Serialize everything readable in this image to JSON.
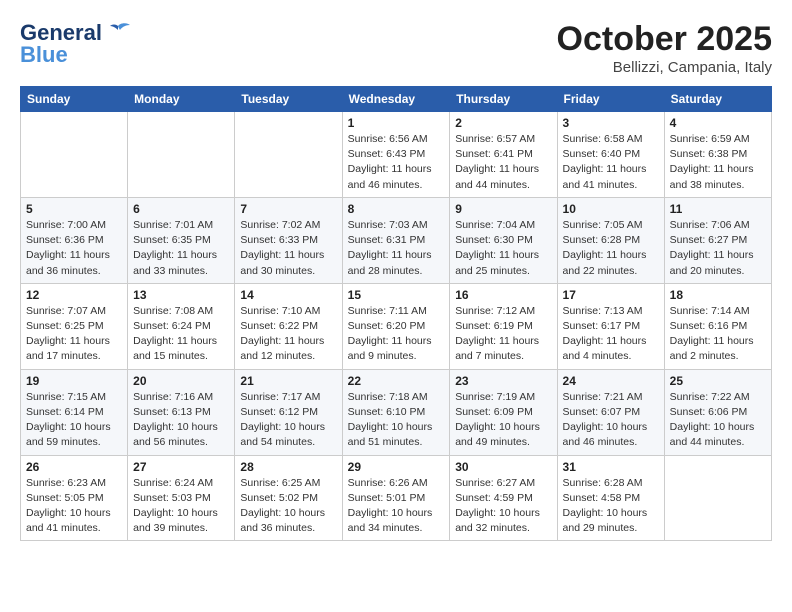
{
  "header": {
    "logo_line1": "General",
    "logo_line2": "Blue",
    "month": "October 2025",
    "location": "Bellizzi, Campania, Italy"
  },
  "days_of_week": [
    "Sunday",
    "Monday",
    "Tuesday",
    "Wednesday",
    "Thursday",
    "Friday",
    "Saturday"
  ],
  "weeks": [
    [
      {
        "day": "",
        "info": ""
      },
      {
        "day": "",
        "info": ""
      },
      {
        "day": "",
        "info": ""
      },
      {
        "day": "1",
        "info": "Sunrise: 6:56 AM\nSunset: 6:43 PM\nDaylight: 11 hours\nand 46 minutes."
      },
      {
        "day": "2",
        "info": "Sunrise: 6:57 AM\nSunset: 6:41 PM\nDaylight: 11 hours\nand 44 minutes."
      },
      {
        "day": "3",
        "info": "Sunrise: 6:58 AM\nSunset: 6:40 PM\nDaylight: 11 hours\nand 41 minutes."
      },
      {
        "day": "4",
        "info": "Sunrise: 6:59 AM\nSunset: 6:38 PM\nDaylight: 11 hours\nand 38 minutes."
      }
    ],
    [
      {
        "day": "5",
        "info": "Sunrise: 7:00 AM\nSunset: 6:36 PM\nDaylight: 11 hours\nand 36 minutes."
      },
      {
        "day": "6",
        "info": "Sunrise: 7:01 AM\nSunset: 6:35 PM\nDaylight: 11 hours\nand 33 minutes."
      },
      {
        "day": "7",
        "info": "Sunrise: 7:02 AM\nSunset: 6:33 PM\nDaylight: 11 hours\nand 30 minutes."
      },
      {
        "day": "8",
        "info": "Sunrise: 7:03 AM\nSunset: 6:31 PM\nDaylight: 11 hours\nand 28 minutes."
      },
      {
        "day": "9",
        "info": "Sunrise: 7:04 AM\nSunset: 6:30 PM\nDaylight: 11 hours\nand 25 minutes."
      },
      {
        "day": "10",
        "info": "Sunrise: 7:05 AM\nSunset: 6:28 PM\nDaylight: 11 hours\nand 22 minutes."
      },
      {
        "day": "11",
        "info": "Sunrise: 7:06 AM\nSunset: 6:27 PM\nDaylight: 11 hours\nand 20 minutes."
      }
    ],
    [
      {
        "day": "12",
        "info": "Sunrise: 7:07 AM\nSunset: 6:25 PM\nDaylight: 11 hours\nand 17 minutes."
      },
      {
        "day": "13",
        "info": "Sunrise: 7:08 AM\nSunset: 6:24 PM\nDaylight: 11 hours\nand 15 minutes."
      },
      {
        "day": "14",
        "info": "Sunrise: 7:10 AM\nSunset: 6:22 PM\nDaylight: 11 hours\nand 12 minutes."
      },
      {
        "day": "15",
        "info": "Sunrise: 7:11 AM\nSunset: 6:20 PM\nDaylight: 11 hours\nand 9 minutes."
      },
      {
        "day": "16",
        "info": "Sunrise: 7:12 AM\nSunset: 6:19 PM\nDaylight: 11 hours\nand 7 minutes."
      },
      {
        "day": "17",
        "info": "Sunrise: 7:13 AM\nSunset: 6:17 PM\nDaylight: 11 hours\nand 4 minutes."
      },
      {
        "day": "18",
        "info": "Sunrise: 7:14 AM\nSunset: 6:16 PM\nDaylight: 11 hours\nand 2 minutes."
      }
    ],
    [
      {
        "day": "19",
        "info": "Sunrise: 7:15 AM\nSunset: 6:14 PM\nDaylight: 10 hours\nand 59 minutes."
      },
      {
        "day": "20",
        "info": "Sunrise: 7:16 AM\nSunset: 6:13 PM\nDaylight: 10 hours\nand 56 minutes."
      },
      {
        "day": "21",
        "info": "Sunrise: 7:17 AM\nSunset: 6:12 PM\nDaylight: 10 hours\nand 54 minutes."
      },
      {
        "day": "22",
        "info": "Sunrise: 7:18 AM\nSunset: 6:10 PM\nDaylight: 10 hours\nand 51 minutes."
      },
      {
        "day": "23",
        "info": "Sunrise: 7:19 AM\nSunset: 6:09 PM\nDaylight: 10 hours\nand 49 minutes."
      },
      {
        "day": "24",
        "info": "Sunrise: 7:21 AM\nSunset: 6:07 PM\nDaylight: 10 hours\nand 46 minutes."
      },
      {
        "day": "25",
        "info": "Sunrise: 7:22 AM\nSunset: 6:06 PM\nDaylight: 10 hours\nand 44 minutes."
      }
    ],
    [
      {
        "day": "26",
        "info": "Sunrise: 6:23 AM\nSunset: 5:05 PM\nDaylight: 10 hours\nand 41 minutes."
      },
      {
        "day": "27",
        "info": "Sunrise: 6:24 AM\nSunset: 5:03 PM\nDaylight: 10 hours\nand 39 minutes."
      },
      {
        "day": "28",
        "info": "Sunrise: 6:25 AM\nSunset: 5:02 PM\nDaylight: 10 hours\nand 36 minutes."
      },
      {
        "day": "29",
        "info": "Sunrise: 6:26 AM\nSunset: 5:01 PM\nDaylight: 10 hours\nand 34 minutes."
      },
      {
        "day": "30",
        "info": "Sunrise: 6:27 AM\nSunset: 4:59 PM\nDaylight: 10 hours\nand 32 minutes."
      },
      {
        "day": "31",
        "info": "Sunrise: 6:28 AM\nSunset: 4:58 PM\nDaylight: 10 hours\nand 29 minutes."
      },
      {
        "day": "",
        "info": ""
      }
    ]
  ]
}
